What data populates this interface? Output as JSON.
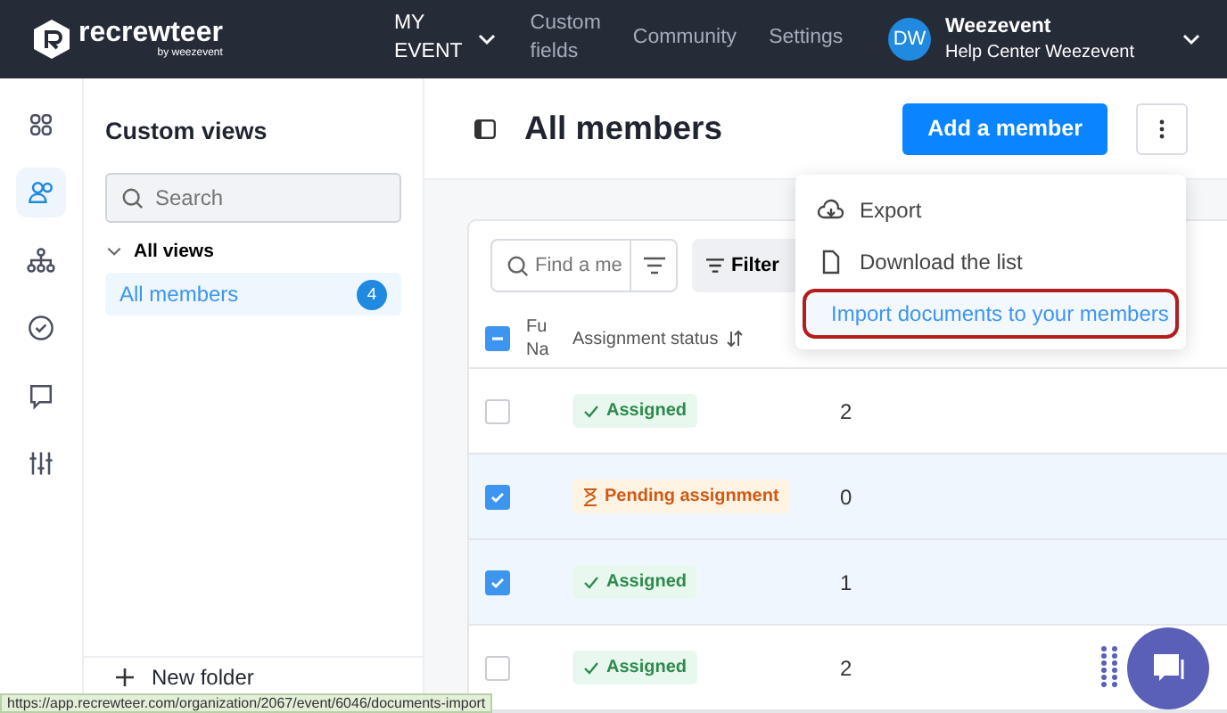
{
  "topbar": {
    "logo": {
      "name": "recrewteer",
      "tagline": "by weezevent"
    },
    "nav": [
      {
        "label": "MY EVENT",
        "dropdown": true
      },
      {
        "label": "Custom fields",
        "dropdown": false
      },
      {
        "label": "Community",
        "dropdown": false
      },
      {
        "label": "Settings",
        "dropdown": false
      }
    ],
    "user": {
      "initials": "DW",
      "name": "Weezevent",
      "org": "Help Center Weezevent"
    }
  },
  "rail": [
    {
      "selected": false
    },
    {
      "selected": true
    },
    {
      "selected": false
    },
    {
      "selected": false
    },
    {
      "selected": false
    },
    {
      "selected": false
    }
  ],
  "views": {
    "title": "Custom views",
    "search": {
      "placeholder": "Search"
    },
    "group": {
      "label": "All views",
      "expanded": true
    },
    "items": [
      {
        "label": "All members",
        "count": "4",
        "selected": true
      }
    ],
    "new_folder": "New folder"
  },
  "main": {
    "title": "All members",
    "add_button": "Add a member",
    "find": {
      "placeholder": "Find a me"
    },
    "filters": "Filter",
    "select_all": {
      "indeterminate": true
    },
    "columns": [
      "Fu\nNa",
      "Assignment status"
    ],
    "rows": [
      {
        "selected": false,
        "status": {
          "kind": "assigned",
          "label": "Assigned"
        },
        "count": "2"
      },
      {
        "selected": true,
        "status": {
          "kind": "pending",
          "label": "Pending assignment"
        },
        "count": "0"
      },
      {
        "selected": true,
        "status": {
          "kind": "assigned",
          "label": "Assigned"
        },
        "count": "1"
      },
      {
        "selected": false,
        "status": {
          "kind": "assigned",
          "label": "Assigned"
        },
        "count": "2"
      }
    ]
  },
  "menu": [
    {
      "label": "Export",
      "highlighted": false
    },
    {
      "label": "Download the list",
      "highlighted": false
    },
    {
      "label": "Import documents to your members",
      "highlighted": true
    }
  ],
  "status_url": "https://app.recrewteer.com/organization/2067/event/6046/documents-import"
}
